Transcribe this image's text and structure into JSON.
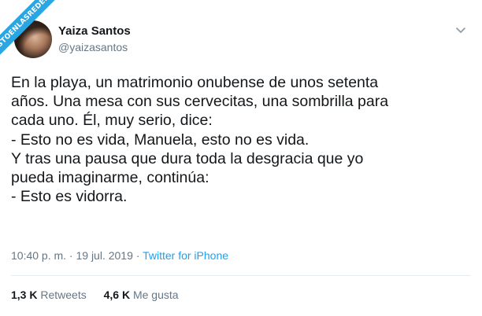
{
  "watermark": {
    "text": "VISTOENLASREDES"
  },
  "author": {
    "name": "Yaiza Santos",
    "handle": "@yaizasantos"
  },
  "icons": {
    "menu": "chevron-down-icon",
    "avatar": "profile-photo"
  },
  "tweet": {
    "lines": [
      "En la playa, un matrimonio onubense de unos setenta",
      "años. Una mesa con sus cervecitas, una sombrilla para",
      "cada uno. Él, muy serio, dice:",
      "- Esto no es vida, Manuela, esto no es vida.",
      "Y tras una pausa que dura toda la desgracia que yo",
      "pueda imaginarme, continúa:",
      "- Esto es vidorra."
    ]
  },
  "meta": {
    "time_date": "10:40 p. m. · 19 jul. 2019 · ",
    "source": "Twitter for iPhone"
  },
  "stats": {
    "retweets_count": "1,3 K",
    "retweets_label": "Retweets",
    "likes_count": "4,6 K",
    "likes_label": "Me gusta"
  },
  "colors": {
    "link": "#1da1f2",
    "muted": "#657786",
    "text": "#14171a",
    "ribbon": "#2aa7e3"
  }
}
